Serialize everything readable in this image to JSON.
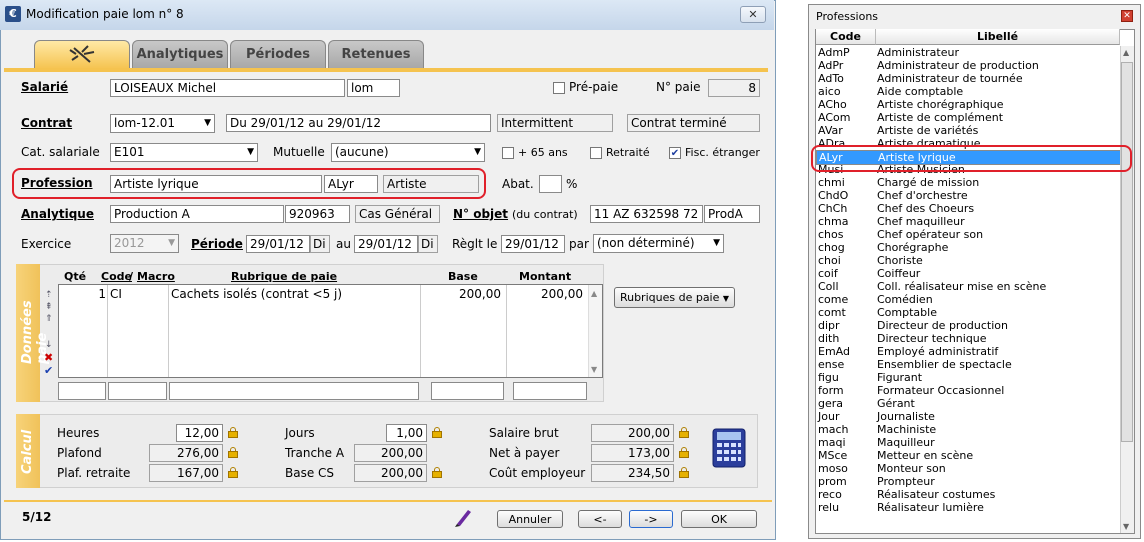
{
  "window": {
    "title": "Modification paie lom n° 8",
    "close": "✕"
  },
  "tabs": [
    {
      "label": ""
    },
    {
      "label": "Analytiques"
    },
    {
      "label": "Périodes"
    },
    {
      "label": "Retenues"
    }
  ],
  "salarie": {
    "label": "Salarié",
    "name": "LOISEAUX Michel",
    "code": "lom",
    "prepaie_label": "Pré-paie",
    "prepaie_checked": false,
    "no_paie_label": "N° paie",
    "no_paie": "8"
  },
  "contrat": {
    "label": "Contrat",
    "value": "lom-12.01",
    "dates": "Du 29/01/12 au 29/01/12",
    "type": "Intermittent",
    "status": "Contrat terminé"
  },
  "cat": {
    "label": "Cat. salariale",
    "value": "E101",
    "mutuelle_label": "Mutuelle",
    "mutuelle": "(aucune)",
    "plus65_label": "+ 65 ans",
    "plus65": false,
    "retraite_label": "Retraité",
    "retraite": false,
    "fisc_label": "Fisc. étranger",
    "fisc": true
  },
  "profession": {
    "label": "Profession",
    "value": "Artiste lyrique",
    "code": "ALyr",
    "category": "Artiste",
    "abat_label": "Abat.",
    "abat": "",
    "percent": "%"
  },
  "analytique": {
    "label": "Analytique",
    "value": "Production A",
    "code": "920963",
    "cas": "Cas Général",
    "objet_label": "N° objet",
    "objet_note": "(du contrat)",
    "objet": "11 AZ 632598 72",
    "objet_code": "ProdA"
  },
  "exercice": {
    "label": "Exercice",
    "value": "2012",
    "periode_label": "Période",
    "from": "29/01/12",
    "from_day": "Di",
    "au": "au",
    "to": "29/01/12",
    "to_day": "Di",
    "reglt_label": "Règlt le",
    "reglt": "29/01/12",
    "par_label": "par",
    "par": "(non déterminé)"
  },
  "donnees": {
    "side_label": "Données paie",
    "headers": {
      "qte": "Qté",
      "code": "Code",
      "macro": "Macro",
      "rubrique": "Rubrique de paie",
      "base": "Base",
      "montant": "Montant"
    },
    "rows": [
      {
        "qte": "1",
        "code": "CI",
        "rubrique": "Cachets isolés (contrat <5 j)",
        "base": "200,00",
        "montant": "200,00"
      }
    ],
    "rubriques_button": "Rubriques de paie"
  },
  "calcul": {
    "side_label": "Calcul",
    "heures_label": "Heures",
    "heures": "12,00",
    "plafond_label": "Plafond",
    "plafond": "276,00",
    "plafret_label": "Plaf. retraite",
    "plafret": "167,00",
    "jours_label": "Jours",
    "jours": "1,00",
    "tranche_label": "Tranche A",
    "tranche": "200,00",
    "basecs_label": "Base CS",
    "basecs": "200,00",
    "brut_label": "Salaire brut",
    "brut": "200,00",
    "net_label": "Net à payer",
    "net": "173,00",
    "cout_label": "Coût employeur",
    "cout": "234,50"
  },
  "footer": {
    "page": "5/12",
    "annuler": "Annuler",
    "prev": "<-",
    "next": "->",
    "ok": "OK"
  },
  "professions": {
    "title": "Professions",
    "col_code": "Code",
    "col_libelle": "Libellé",
    "items": [
      [
        "AdmP",
        "Administrateur"
      ],
      [
        "AdPr",
        "Administrateur de production"
      ],
      [
        "AdTo",
        "Administrateur de tournée"
      ],
      [
        "aico",
        "Aide comptable"
      ],
      [
        "ACho",
        "Artiste chorégraphique"
      ],
      [
        "ACom",
        "Artiste de complément"
      ],
      [
        "AVar",
        "Artiste de variétés"
      ],
      [
        "ADra",
        "Artiste dramatique"
      ],
      [
        "ALyr",
        "Artiste lyrique"
      ],
      [
        "Musi",
        "Artiste Musicien"
      ],
      [
        "chmi",
        "Chargé de mission"
      ],
      [
        "ChdO",
        "Chef d'orchestre"
      ],
      [
        "ChCh",
        "Chef des Choeurs"
      ],
      [
        "chma",
        "Chef maquilleur"
      ],
      [
        "chos",
        "Chef opérateur son"
      ],
      [
        "chog",
        "Chorégraphe"
      ],
      [
        "choi",
        "Choriste"
      ],
      [
        "coif",
        "Coiffeur"
      ],
      [
        "Coll",
        "Coll. réalisateur mise en scène"
      ],
      [
        "come",
        "Comédien"
      ],
      [
        "comt",
        "Comptable"
      ],
      [
        "dipr",
        "Directeur de production"
      ],
      [
        "dith",
        "Directeur technique"
      ],
      [
        "EmAd",
        "Employé administratif"
      ],
      [
        "ense",
        "Ensemblier de spectacle"
      ],
      [
        "figu",
        "Figurant"
      ],
      [
        "form",
        "Formateur Occasionnel"
      ],
      [
        "gera",
        "Gérant"
      ],
      [
        "Jour",
        "Journaliste"
      ],
      [
        "mach",
        "Machiniste"
      ],
      [
        "maqi",
        "Maquilleur"
      ],
      [
        "MSce",
        "Metteur en scène"
      ],
      [
        "moso",
        "Monteur son"
      ],
      [
        "prom",
        "Prompteur"
      ],
      [
        "reco",
        "Réalisateur costumes"
      ],
      [
        "relu",
        "Réalisateur lumière"
      ]
    ],
    "selected_index": 8
  }
}
